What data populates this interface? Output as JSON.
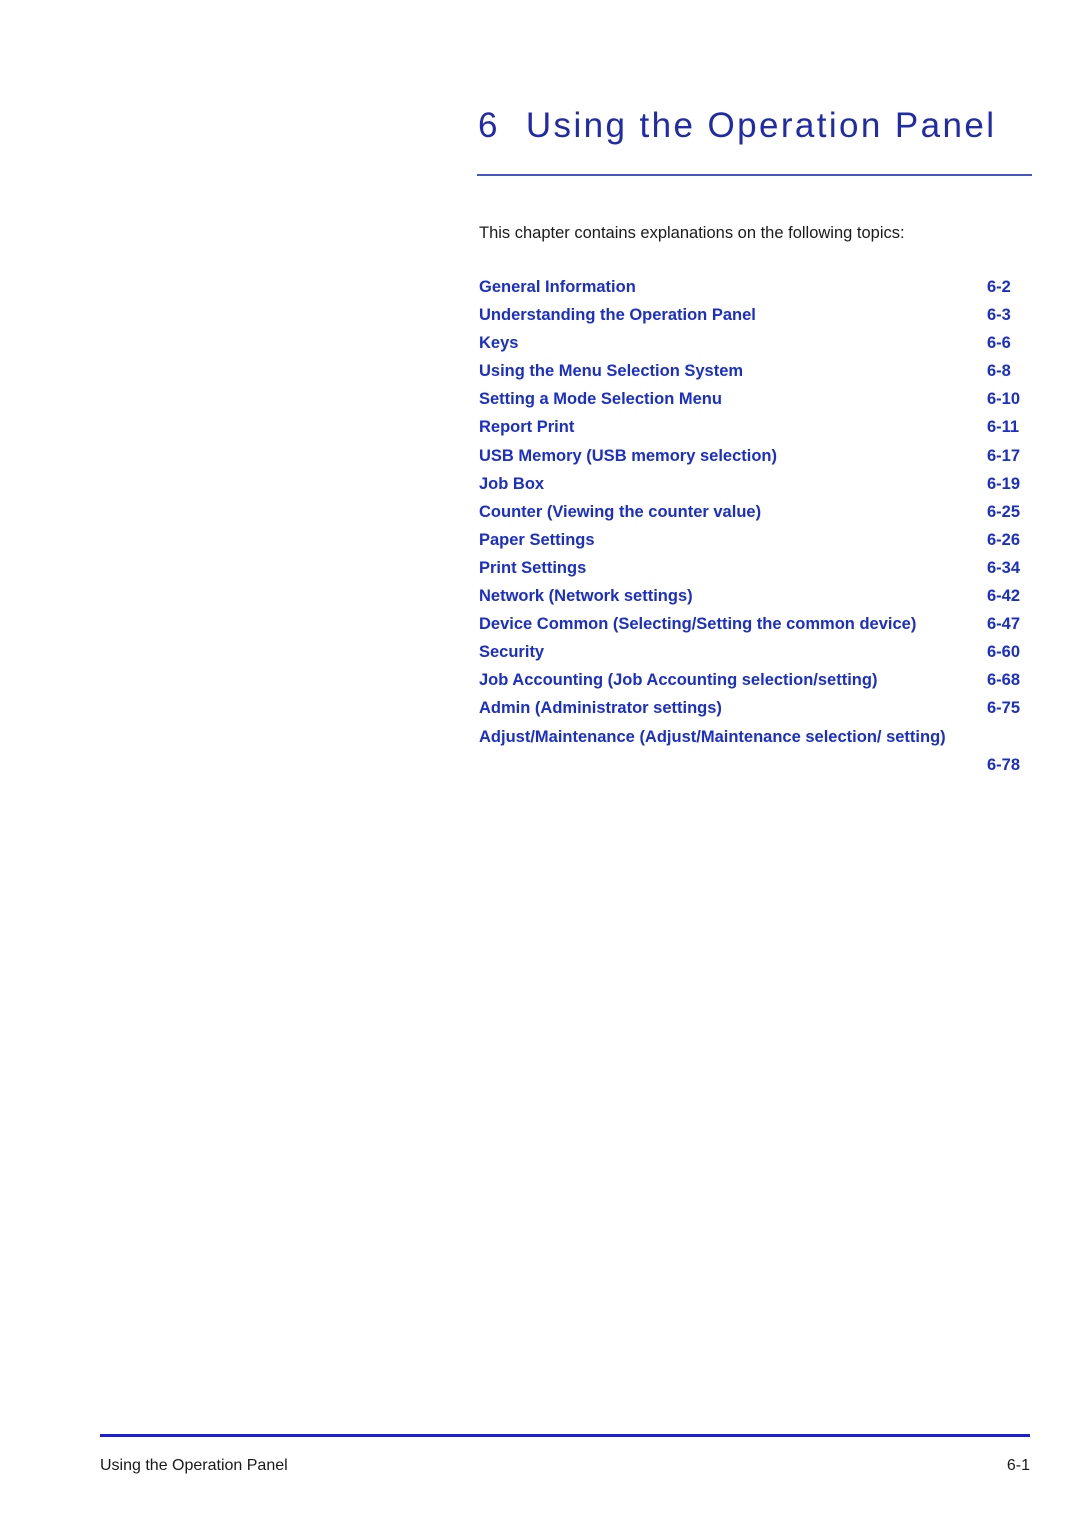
{
  "chapter": {
    "number": "6",
    "title": "Using the Operation Panel"
  },
  "intro": "This chapter contains explanations on the following topics:",
  "toc": [
    {
      "label": "General Information",
      "page": "6-2"
    },
    {
      "label": "Understanding the Operation Panel",
      "page": "6-3"
    },
    {
      "label": "Keys",
      "page": "6-6"
    },
    {
      "label": "Using the Menu Selection System",
      "page": "6-8"
    },
    {
      "label": "Setting a Mode Selection Menu",
      "page": "6-10"
    },
    {
      "label": "Report Print",
      "page": "6-11"
    },
    {
      "label": "USB Memory (USB memory selection)",
      "page": "6-17"
    },
    {
      "label": "Job Box",
      "page": "6-19"
    },
    {
      "label": "Counter (Viewing the counter value)",
      "page": "6-25"
    },
    {
      "label": "Paper Settings",
      "page": "6-26"
    },
    {
      "label": "Print Settings",
      "page": "6-34"
    },
    {
      "label": "Network (Network settings)",
      "page": "6-42"
    },
    {
      "label": "Device Common (Selecting/Setting the common device)",
      "page": "6-47"
    },
    {
      "label": "Security",
      "page": "6-60"
    },
    {
      "label": "Job Accounting (Job Accounting selection/setting)",
      "page": "6-68"
    },
    {
      "label": "Admin (Administrator settings)",
      "page": "6-75"
    },
    {
      "label": "Adjust/Maintenance (Adjust/Maintenance selection/ setting)",
      "page": "6-78",
      "wrapped": true
    }
  ],
  "footer": {
    "left": "Using the Operation Panel",
    "right": "6-1"
  },
  "colors": {
    "heading_blue": "#1f2aad",
    "toc_blue": "#1a2ecc",
    "rule_blue": "#4357c8",
    "footer_rule_blue": "#1b1fdc",
    "body_text": "#1a1a1a"
  }
}
